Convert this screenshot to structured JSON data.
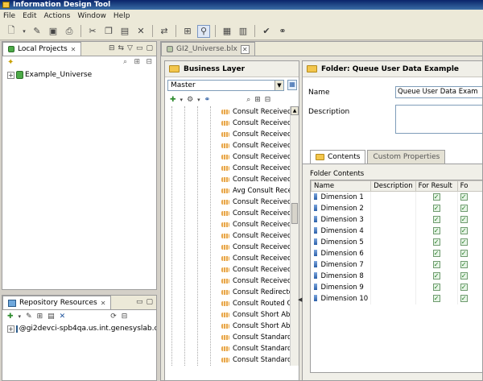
{
  "window": {
    "title": "Information Design Tool"
  },
  "menu": [
    "File",
    "Edit",
    "Actions",
    "Window",
    "Help"
  ],
  "local_projects": {
    "tab_label": "Local Projects",
    "items": [
      {
        "label": "Example_Universe"
      }
    ]
  },
  "repository": {
    "tab_label": "Repository Resources",
    "items": [
      {
        "label": "@gi2devci-spb4qa.us.int.genesyslab.c"
      }
    ]
  },
  "editor_tab": {
    "label": "GI2_Universe.blx"
  },
  "business_layer": {
    "title": "Business Layer",
    "view_select": "Master",
    "items": [
      "Consult Received",
      "Consult Received",
      "Consult Received",
      "Consult Received",
      "Consult Received",
      "Consult Received",
      "Consult Received",
      "Avg Consult Rece",
      "Consult Received",
      "Consult Received",
      "Consult Received",
      "Consult Received",
      "Consult Received",
      "Consult Received",
      "Consult Received",
      "Consult Received",
      "Consult Redirecte",
      "Consult Routed C",
      "Consult Short Aba",
      "Consult Short Aba",
      "Consult Standard",
      "Consult Standard",
      "Consult Standard",
      "Consult Standard"
    ]
  },
  "folder": {
    "header": "Folder: Queue User Data Example",
    "name_label": "Name",
    "name_value": "Queue User Data Exam",
    "description_label": "Description",
    "tabs": [
      "Contents",
      "Custom Properties"
    ],
    "contents_label": "Folder Contents",
    "columns": [
      "Name",
      "Description",
      "For Result",
      "Fo"
    ],
    "rows": [
      {
        "name": "Dimension 1"
      },
      {
        "name": "Dimension 2"
      },
      {
        "name": "Dimension 3"
      },
      {
        "name": "Dimension 4"
      },
      {
        "name": "Dimension 5"
      },
      {
        "name": "Dimension 6"
      },
      {
        "name": "Dimension 7"
      },
      {
        "name": "Dimension 8"
      },
      {
        "name": "Dimension 9"
      },
      {
        "name": "Dimension 10"
      }
    ]
  }
}
